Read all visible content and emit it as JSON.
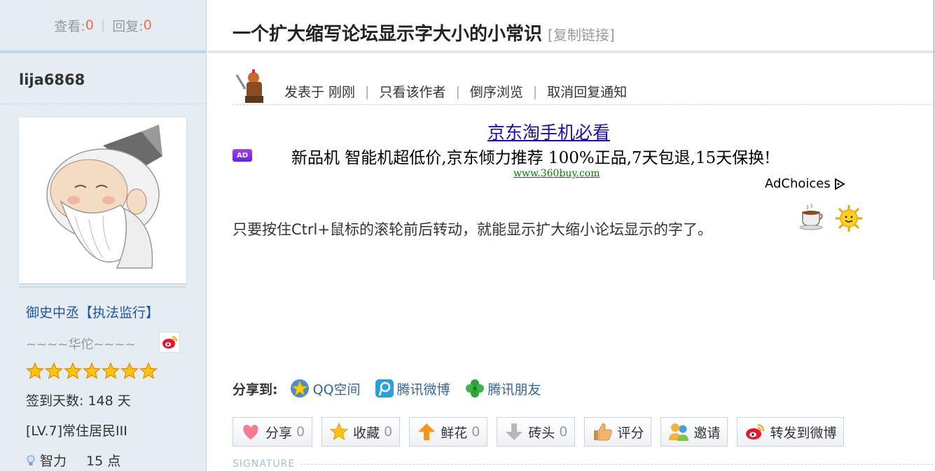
{
  "stats": {
    "views_label": "查看:",
    "views_value": "0",
    "separator": "|",
    "replies_label": "回复:",
    "replies_value": "0"
  },
  "user": {
    "username": "lija6868",
    "title": "御史中丞【执法监行】",
    "custom_text": "~~~~华佗~~~~",
    "star_count": 7,
    "sign_days": "签到天数: 148 天",
    "level": "[LV.7]常住居民III",
    "intelligence_label": "智力",
    "intelligence_value": "15 点"
  },
  "thread": {
    "title": "一个扩大缩写论坛显示字大小的小常识",
    "copy_link": "[复制链接]"
  },
  "author_bar": {
    "posted": "发表于 刚刚",
    "only_author": "只看该作者",
    "reverse": "倒序浏览",
    "cancel_notify": "取消回复通知",
    "pipe": "|"
  },
  "ad": {
    "badge": "AD",
    "title": "京东淘手机必看",
    "description": "新品机 智能机超低价,京东倾力推荐 100%正品,7天包退,15天保换!",
    "url": "www.360buy.com",
    "adchoices": "AdChoices"
  },
  "message": "只要按住Ctrl+鼠标的滚轮前后转动，就能显示扩大缩小论坛显示的字了。",
  "share": {
    "label": "分享到:",
    "qzone": "QQ空间",
    "tweibo": "腾讯微博",
    "pengyou": "腾讯朋友"
  },
  "actions": {
    "share": "分享",
    "share_count": "0",
    "favorite": "收藏",
    "favorite_count": "0",
    "flower": "鲜花",
    "flower_count": "0",
    "brick": "砖头",
    "brick_count": "0",
    "rate": "评分",
    "invite": "邀请",
    "forward_weibo": "转发到微博"
  },
  "signature": "SIGNATURE",
  "colors": {
    "panel_bg": "#e5edf2",
    "count_red": "#f26c4f",
    "link_blue": "#2255aa",
    "ad_link": "#1a0dab",
    "ad_url_green": "#008000"
  }
}
